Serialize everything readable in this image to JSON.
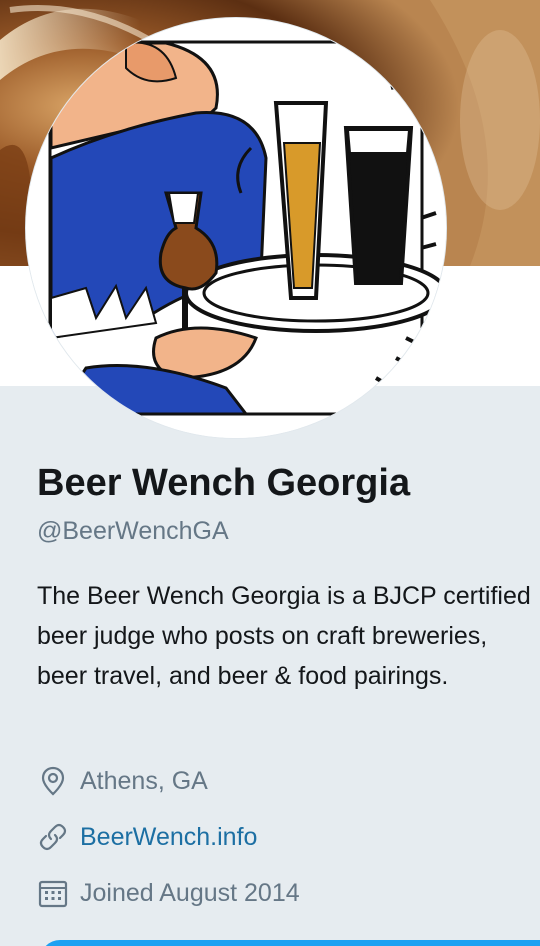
{
  "profile": {
    "name": "Beer Wench Georgia",
    "handle": "@BeerWenchGA",
    "bio": "The Beer Wench Georgia is a BJCP certified beer judge who posts on craft breweries, beer travel, and beer & food pairings.",
    "location": "Athens, GA",
    "website": "BeerWench.info",
    "joined": "Joined August 2014"
  },
  "icons": {
    "location": "location-pin-icon",
    "link": "link-icon",
    "calendar": "calendar-icon"
  },
  "colors": {
    "background": "#e6ecf0",
    "text_primary": "#14171a",
    "text_secondary": "#657786",
    "link": "#1c6fa3",
    "accent": "#1da1f2"
  }
}
